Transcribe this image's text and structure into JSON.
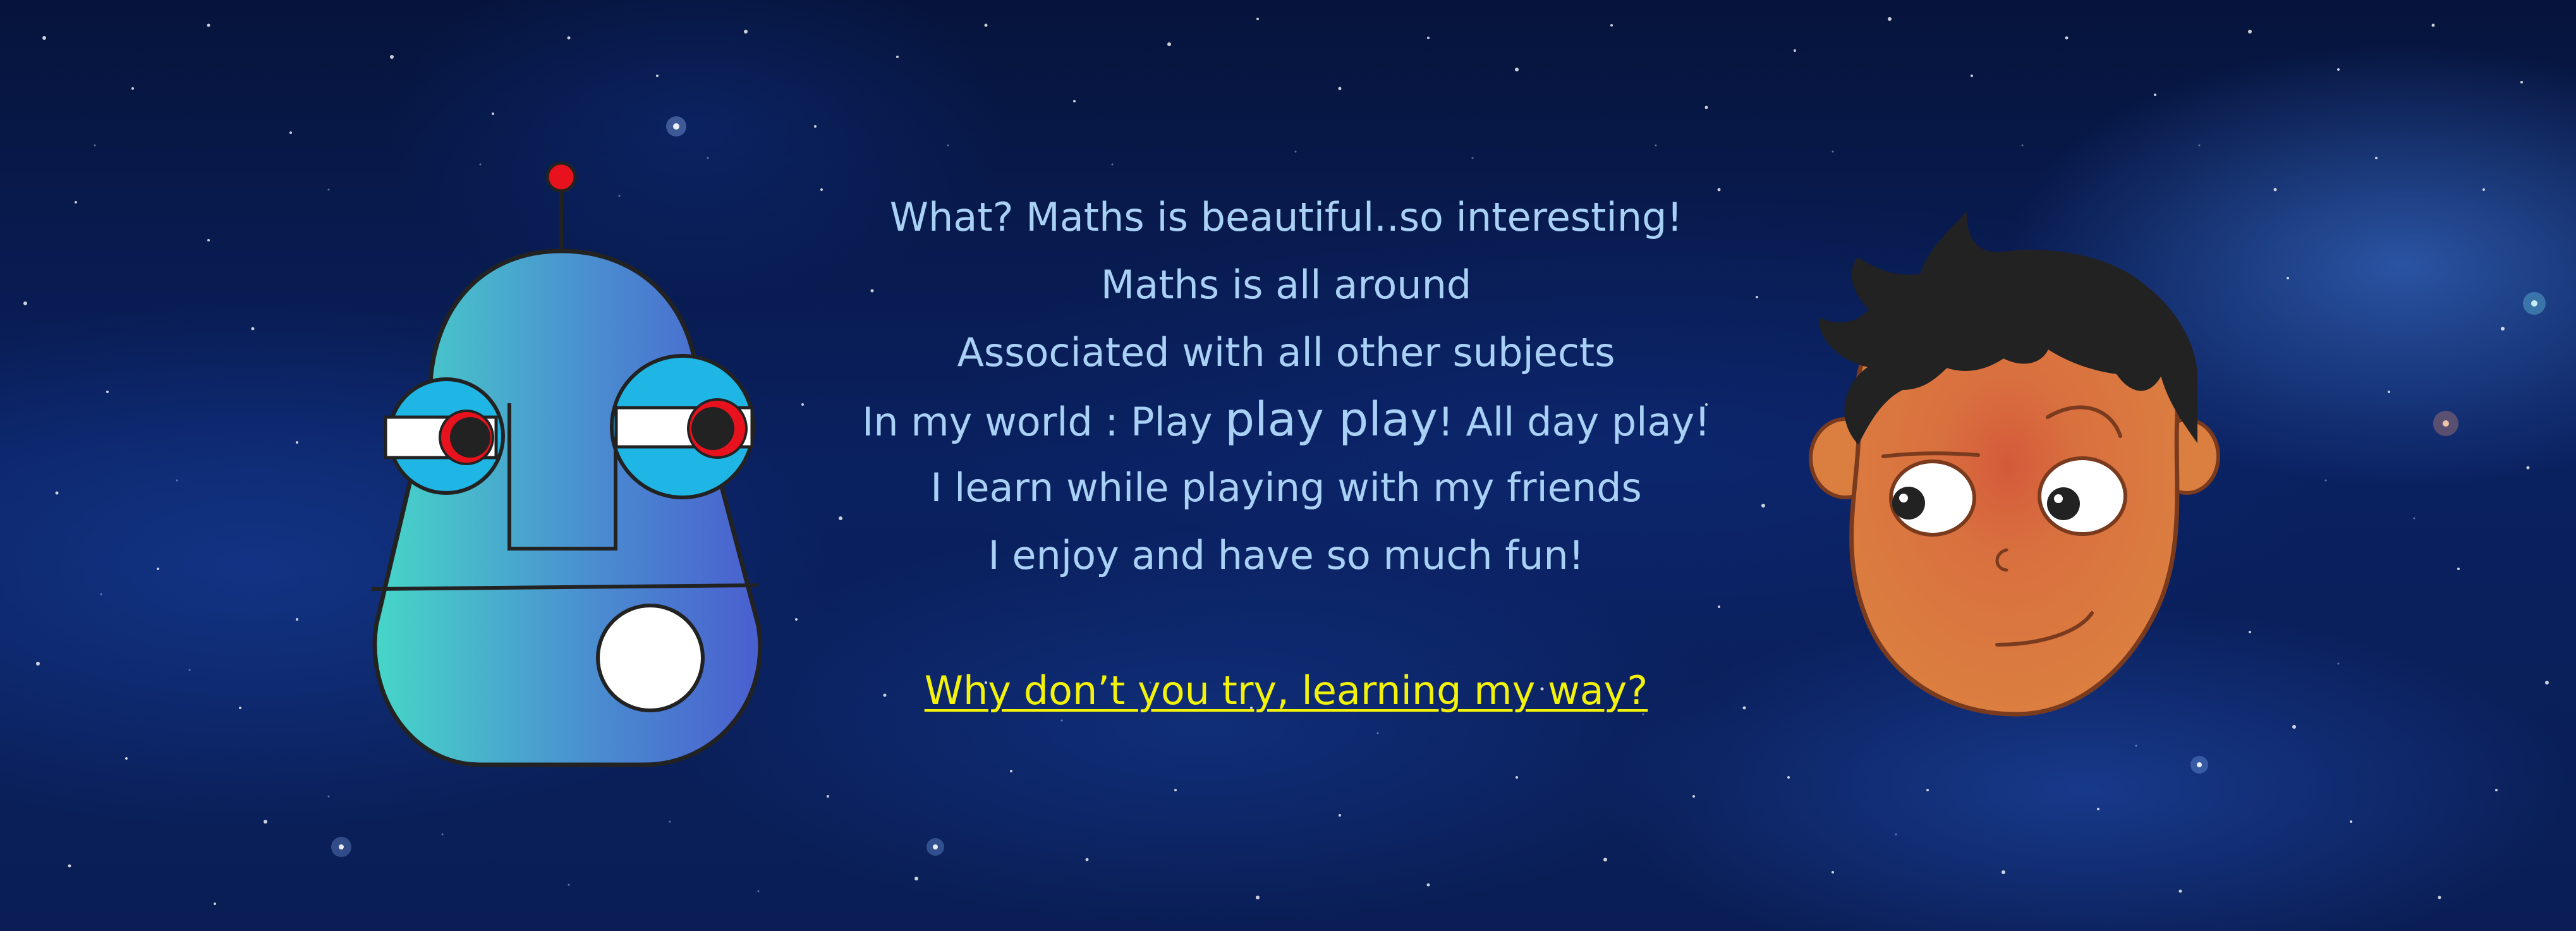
{
  "message": {
    "line1": "What? Maths is beautiful..so interesting!",
    "line2": "Maths is all around",
    "line3": "Associated with all other subjects",
    "line4_prefix": "In my world : Play ",
    "line4_emphasis": "play play",
    "line4_suffix": "! All day play!",
    "line5": "I learn while playing with my friends",
    "line6": "I enjoy and have so much fun!",
    "cta": "Why don’t you try, learning my way?"
  },
  "colors": {
    "background": "#0a1e55",
    "text": "#a9d0f5",
    "cta": "#f2f20a",
    "robot_gradient_start": "#46d6c8",
    "robot_gradient_end": "#4a5fd0",
    "robot_antenna": "#e8121e",
    "boy_skin": "#d9783f",
    "boy_hair": "#222222"
  },
  "illustrations": {
    "left": "robot-illustration",
    "right": "boy-face-illustration"
  }
}
